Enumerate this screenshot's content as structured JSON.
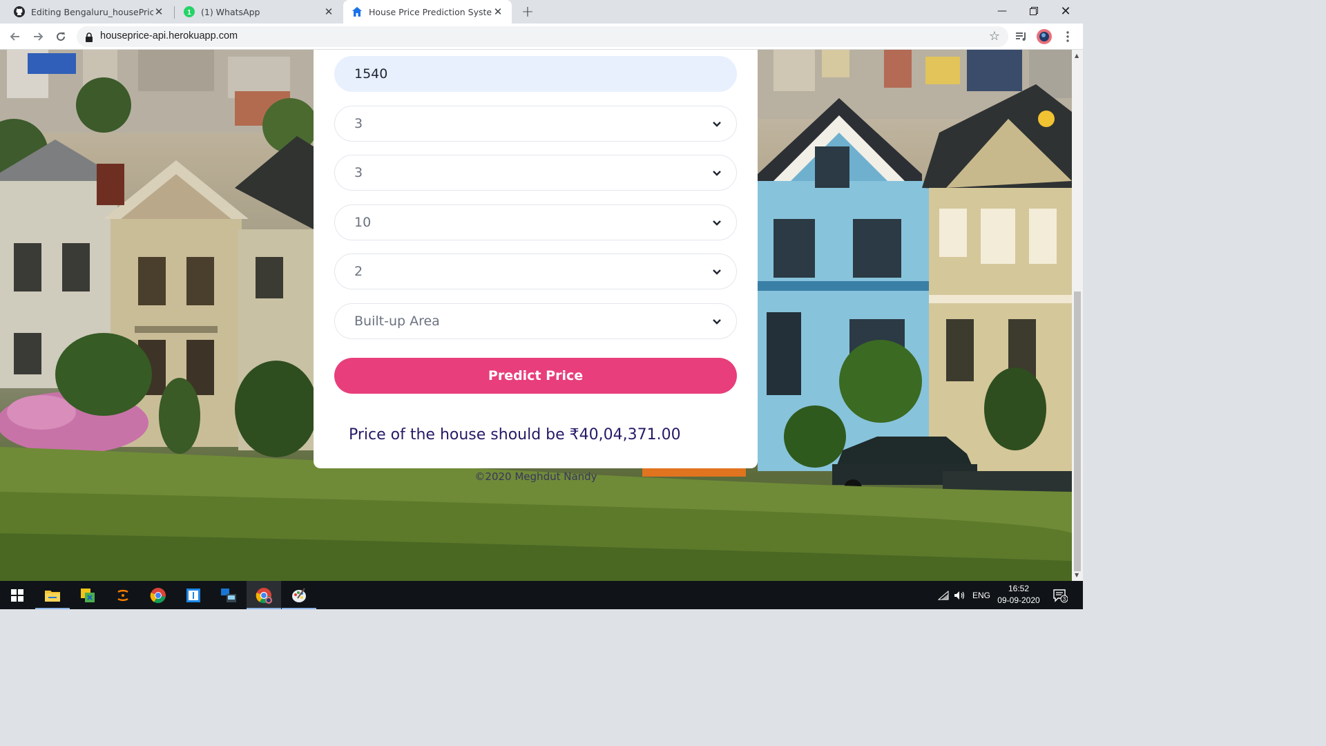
{
  "browser": {
    "tabs": [
      {
        "title": "Editing Bengaluru_housePrice_m",
        "icon": "github-icon",
        "active": false
      },
      {
        "title": "(1) WhatsApp",
        "icon": "whatsapp-icon",
        "badge": "1",
        "active": false
      },
      {
        "title": "House Price Prediction System",
        "icon": "house-icon",
        "active": true
      }
    ],
    "url": "houseprice-api.herokuapp.com"
  },
  "form": {
    "area_value": "1540",
    "bhk_value": "3",
    "bath_value": "3",
    "location_value": "10",
    "balcony_value": "2",
    "area_type_placeholder": "Built-up Area",
    "predict_label": "Predict Price"
  },
  "result": {
    "text": "Price of the house should be ₹40,04,371.00"
  },
  "footer": {
    "copyright": "©2020 Meghdut Nandy"
  },
  "taskbar": {
    "apps": [
      "windows-start-icon",
      "file-explorer-icon",
      "sticky-app-icon",
      "anaconda-icon",
      "chrome-icon",
      "app-square-icon",
      "remote-app-icon",
      "chrome-active-icon",
      "paint-icon"
    ],
    "language": "ENG",
    "time": "16:52",
    "date": "09-09-2020",
    "notifications": "3"
  },
  "colors": {
    "accent": "#e83e7c",
    "result_text": "#241a66",
    "input_fill": "#e8f0fe"
  }
}
